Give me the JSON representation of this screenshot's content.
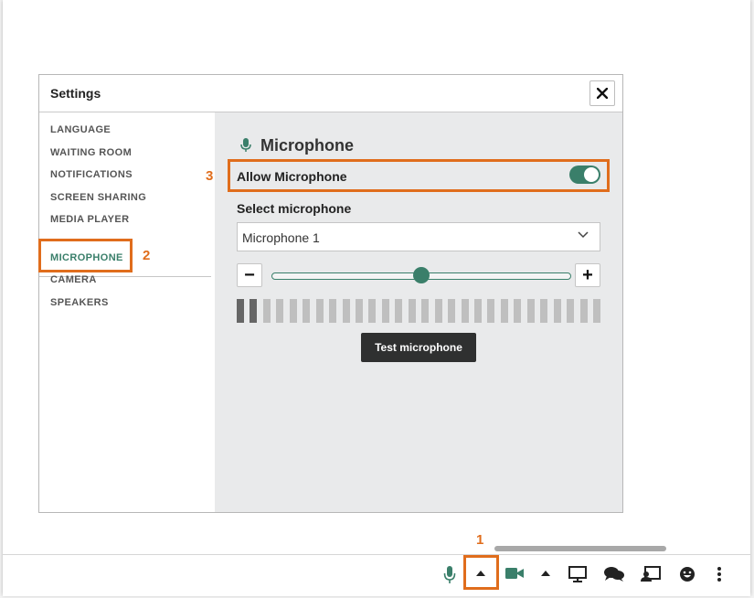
{
  "dialog": {
    "title": "Settings",
    "close_label": "✕"
  },
  "sidebar": {
    "items": [
      {
        "label": "LANGUAGE"
      },
      {
        "label": "WAITING ROOM"
      },
      {
        "label": "NOTIFICATIONS"
      },
      {
        "label": "SCREEN SHARING"
      },
      {
        "label": "MEDIA PLAYER"
      },
      {
        "label": "MICROPHONE",
        "active": true
      },
      {
        "label": "CAMERA"
      },
      {
        "label": "SPEAKERS"
      }
    ]
  },
  "content": {
    "section_title": "Microphone",
    "allow_label": "Allow Microphone",
    "allow_enabled": true,
    "select_label": "Select microphone",
    "select_value": "Microphone 1",
    "volume_minus": "−",
    "volume_plus": "+",
    "volume_level": 0.5,
    "meter_segments": 28,
    "meter_active": 2,
    "test_button": "Test microphone"
  },
  "annotations": {
    "one": "1",
    "two": "2",
    "three": "3"
  },
  "toolbar": {
    "icons": [
      "microphone-icon",
      "caret-up-icon",
      "camera-icon",
      "caret-up-icon",
      "monitor-icon",
      "chat-icon",
      "cast-icon",
      "emoji-icon",
      "more-icon"
    ]
  },
  "colors": {
    "accent": "#3a7f6a",
    "annotation": "#e06d1c",
    "button_dark": "#2f3030"
  }
}
